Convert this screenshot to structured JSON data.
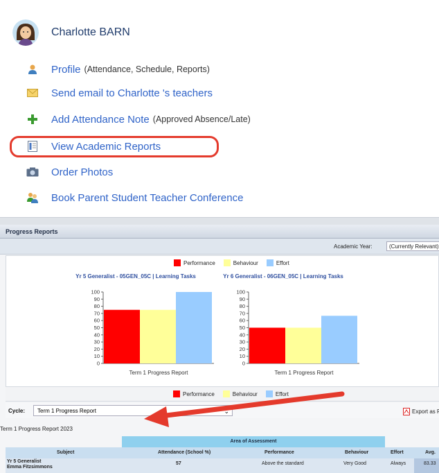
{
  "student": {
    "name": "Charlotte BARN"
  },
  "menu": {
    "profile": {
      "label": "Profile",
      "sub": "(Attendance, Schedule, Reports)"
    },
    "email": {
      "label": "Send email to Charlotte 's teachers"
    },
    "attendance": {
      "label": "Add Attendance Note",
      "sub": "(Approved Absence/Late)"
    },
    "reports": {
      "label": "View Academic Reports"
    },
    "photos": {
      "label": "Order Photos"
    },
    "conference": {
      "label": "Book Parent Student Teacher Conference"
    }
  },
  "progress": {
    "header": "Progress Reports",
    "academic_year_label": "Academic Year:",
    "academic_year_value": "(Currently Relevant)",
    "legend": [
      "Performance",
      "Behaviour",
      "Effort"
    ],
    "cycle_label": "Cycle:",
    "cycle_value": "Term 1 Progress Report",
    "export_label": "Export as PD",
    "report_title": "Term 1 Progress Report 2023",
    "table": {
      "area_header": "Area of Assessment",
      "columns": [
        "Subject",
        "Attendance (School %)",
        "Performance",
        "Behaviour",
        "Effort",
        "Avg."
      ],
      "rows": [
        {
          "subject": "Yr 5 Generalist",
          "teacher": "Emma Fitzsimmons",
          "attendance": "57",
          "performance": "Above the standard",
          "behaviour": "Very Good",
          "effort": "Always",
          "avg": "83.33"
        }
      ]
    }
  },
  "colors": {
    "performance": "#ff0000",
    "behaviour": "#ffff99",
    "effort": "#99ccff",
    "link": "#2f63c8",
    "highlight": "#e43a2c"
  },
  "chart_data": [
    {
      "type": "bar",
      "title": "Yr 5 Generalist - 05GEN_05C | Learning Tasks",
      "categories": [
        "Term 1 Progress Report"
      ],
      "series": [
        {
          "name": "Performance",
          "values": [
            75
          ]
        },
        {
          "name": "Behaviour",
          "values": [
            75
          ]
        },
        {
          "name": "Effort",
          "values": [
            100
          ]
        }
      ],
      "ylim": [
        0,
        100
      ],
      "yticks": [
        0,
        10,
        20,
        30,
        40,
        50,
        60,
        70,
        80,
        90,
        100
      ],
      "legend": "top"
    },
    {
      "type": "bar",
      "title": "Yr 6 Generalist - 06GEN_05C | Learning Tasks",
      "categories": [
        "Term 1 Progress Report"
      ],
      "series": [
        {
          "name": "Performance",
          "values": [
            50
          ]
        },
        {
          "name": "Behaviour",
          "values": [
            50
          ]
        },
        {
          "name": "Effort",
          "values": [
            66.67
          ]
        }
      ],
      "ylim": [
        0,
        100
      ],
      "yticks": [
        0,
        10,
        20,
        30,
        40,
        50,
        60,
        70,
        80,
        90,
        100
      ],
      "legend": "top"
    }
  ]
}
